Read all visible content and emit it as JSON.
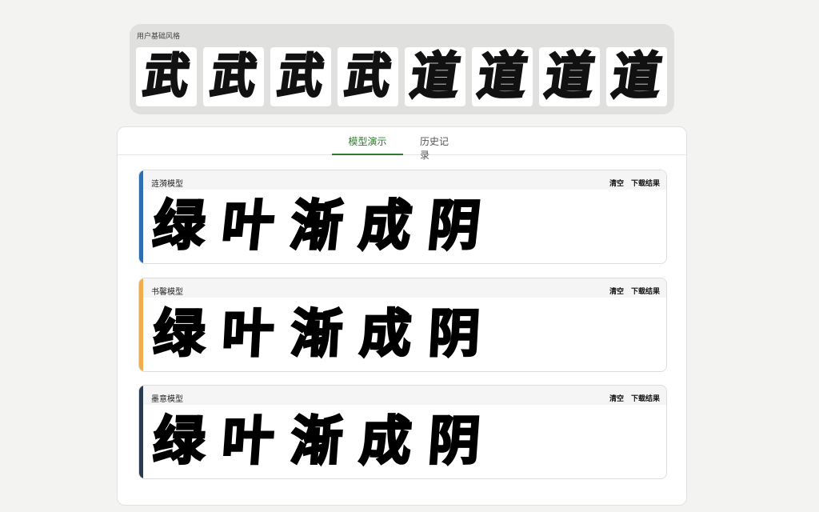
{
  "style_strip": {
    "title": "用户基础风格",
    "thumbs": [
      "武",
      "武",
      "武",
      "武",
      "道",
      "道",
      "道",
      "道"
    ]
  },
  "tabs": {
    "demo": "模型演示",
    "history": "历史记录"
  },
  "cards": [
    {
      "title": "涟漪模型",
      "accent": "#2f6db0",
      "clear": "清空",
      "download": "下载结果",
      "glyphs": [
        "绿",
        "叶",
        "渐",
        "成",
        "阴"
      ]
    },
    {
      "title": "书馨模型",
      "accent": "#f0ad4e",
      "clear": "清空",
      "download": "下载结果",
      "glyphs": [
        "绿",
        "叶",
        "渐",
        "成",
        "阴"
      ]
    },
    {
      "title": "墨意模型",
      "accent": "#2a3a4f",
      "clear": "清空",
      "download": "下载结果",
      "glyphs": [
        "绿",
        "叶",
        "渐",
        "成",
        "阴"
      ]
    }
  ]
}
